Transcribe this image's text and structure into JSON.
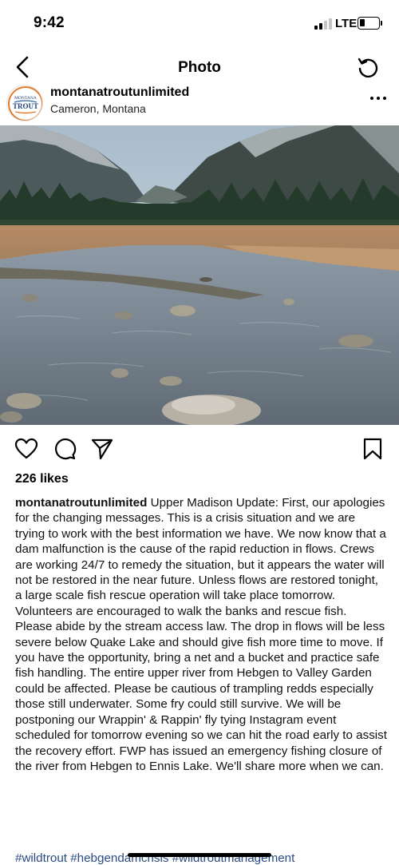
{
  "status_bar": {
    "time": "9:42",
    "network": "LTE",
    "battery_fraction": 0.3
  },
  "nav": {
    "title": "Photo"
  },
  "post": {
    "username": "montanatroutunlimited",
    "location": "Cameron, Montana",
    "avatar_text_top": "MONTANA",
    "avatar_text_main": "TROUT",
    "likes": "226 likes",
    "caption_user": "montanatroutunlimited",
    "caption_text": " Upper Madison Update: First, our apologies for the changing messages. This is a crisis situation and we are trying to work with the best information we have. We now know that a dam malfunction is the cause of the rapid reduction in flows. Crews are working 24/7 to remedy the situation, but it appears the water will not be restored in the near future. Unless flows are restored tonight, a large scale fish rescue operation will take place tomorrow. Volunteers are encouraged to walk the banks and rescue fish. Please abide by the stream access law. The drop in flows will be less severe below Quake Lake and should give fish more time to move. If you have the opportunity, bring a net and a bucket and practice safe fish handling. The entire upper river from Hebgen to Valley Garden could be affected. Please be cautious of trampling redds especially those still underwater. Some fry could still survive. We will be postponing our Wrappin' & Rappin' fly tying Instagram event scheduled for tomorrow evening so we can hit the road early to assist the recovery effort. FWP has issued an emergency fishing closure of the river from Hebgen to Ennis Lake. We'll share more when we can.",
    "hashtags": "#wildtrout #hebgendamcrisis #wildtroutmanagement"
  },
  "icons": {
    "back": "chevron-left-icon",
    "refresh": "refresh-icon",
    "more": "more-dots-icon",
    "like": "heart-icon",
    "comment": "comment-icon",
    "share": "send-icon",
    "save": "bookmark-icon"
  },
  "colors": {
    "hashtag": "#2a4a82",
    "avatar_accent": "#e07a2e"
  }
}
